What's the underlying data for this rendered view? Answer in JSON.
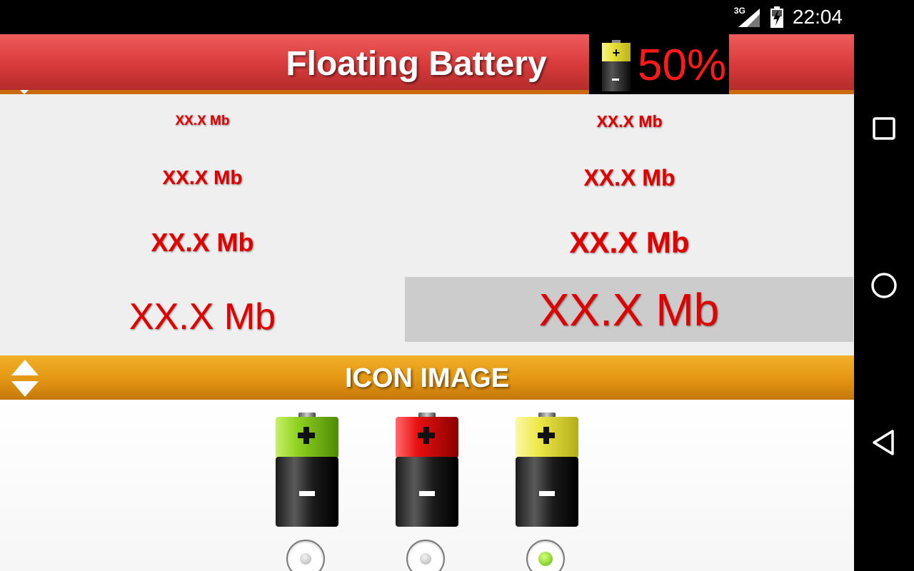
{
  "status_bar": {
    "network": "3G",
    "time": "22:04",
    "icons": [
      "signal-icon",
      "battery-charging-icon"
    ]
  },
  "header": {
    "title": "Floating Battery",
    "preview_percent": "50%",
    "preview_icon": "battery-yellow-icon"
  },
  "text_sizes": {
    "items": [
      {
        "label": "XX.X Mb",
        "selected": false
      },
      {
        "label": "XX.X Mb",
        "selected": false
      },
      {
        "label": "XX.X Mb",
        "selected": false
      },
      {
        "label": "XX.X Mb",
        "selected": false
      },
      {
        "label": "XX.X Mb",
        "selected": false
      },
      {
        "label": "XX.X Mb",
        "selected": false
      },
      {
        "label": "XX.X Mb",
        "selected": false
      },
      {
        "label": "XX.X Mb",
        "selected": true
      }
    ],
    "text_color": "#e00000",
    "selected_bg": "#cccccc"
  },
  "section": {
    "title": "ICON IMAGE",
    "toggle_icon": "expand-collapse-arrows-icon"
  },
  "icon_options": [
    {
      "name": "green",
      "color": "#8fd11f",
      "selected": false,
      "icon": "battery-green-icon"
    },
    {
      "name": "red",
      "color": "#e81010",
      "selected": false,
      "icon": "battery-red-icon"
    },
    {
      "name": "yellow",
      "color": "#efe94a",
      "selected": true,
      "icon": "battery-yellow-icon"
    }
  ],
  "nav_bar": {
    "buttons": [
      "recents-icon",
      "home-icon",
      "back-icon"
    ]
  },
  "colors": {
    "header_red": "#d83a3a",
    "section_orange": "#e39612",
    "preview_text": "#ff1a1a"
  }
}
